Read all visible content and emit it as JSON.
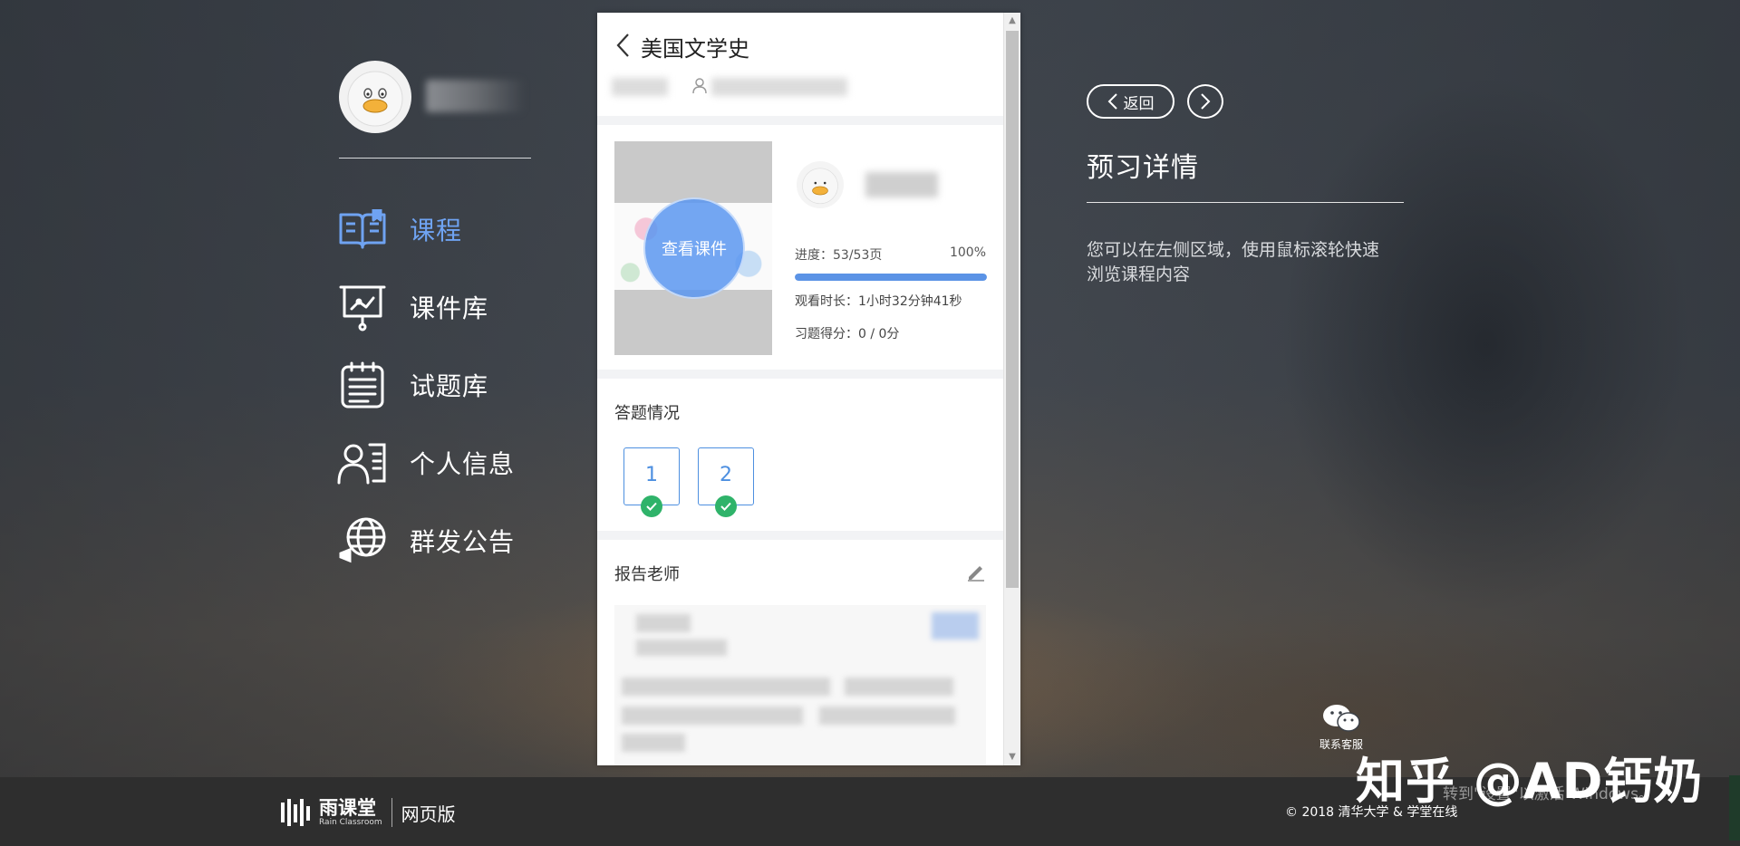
{
  "panel": {
    "course_title": "美国文学史",
    "view_slides_label": "查看课件",
    "progress_label": "进度：53/53页",
    "progress_percent": "100%",
    "progress_value": 1.0,
    "watch_time_label": "观看时长：",
    "watch_time_value": "1小时32分钟41秒",
    "exercise_score_label": "习题得分：",
    "exercise_score_value": "0 / 0分",
    "answers_title": "答题情况",
    "questions": [
      "1",
      "2"
    ],
    "report_title": "报告老师"
  },
  "sidebar": {
    "items": [
      {
        "label": "课程",
        "icon": "book-icon"
      },
      {
        "label": "课件库",
        "icon": "presentation-icon"
      },
      {
        "label": "试题库",
        "icon": "notepad-icon"
      },
      {
        "label": "个人信息",
        "icon": "profile-card-icon"
      },
      {
        "label": "群发公告",
        "icon": "globe-megaphone-icon"
      }
    ],
    "active_index": 0
  },
  "right": {
    "back_label": "返回",
    "title": "预习详情",
    "description": "您可以在左侧区域，使用鼠标滚轮快速浏览课程内容"
  },
  "footer": {
    "logo_cn": "雨课堂",
    "logo_en": "Rain Classroom",
    "logo_web": "网页版",
    "copyright": "© 2018 清华大学 & 学堂在线"
  },
  "service_label": "联系客服",
  "watermark": "知乎 @AD钙奶",
  "activate_text": "转到\"设置\"以激活 Windows。",
  "colors": {
    "accent": "#5b93e6",
    "active_nav": "#6fa3f2",
    "check_green": "#2fb36a",
    "footer_bg": "#2e2e2e"
  }
}
